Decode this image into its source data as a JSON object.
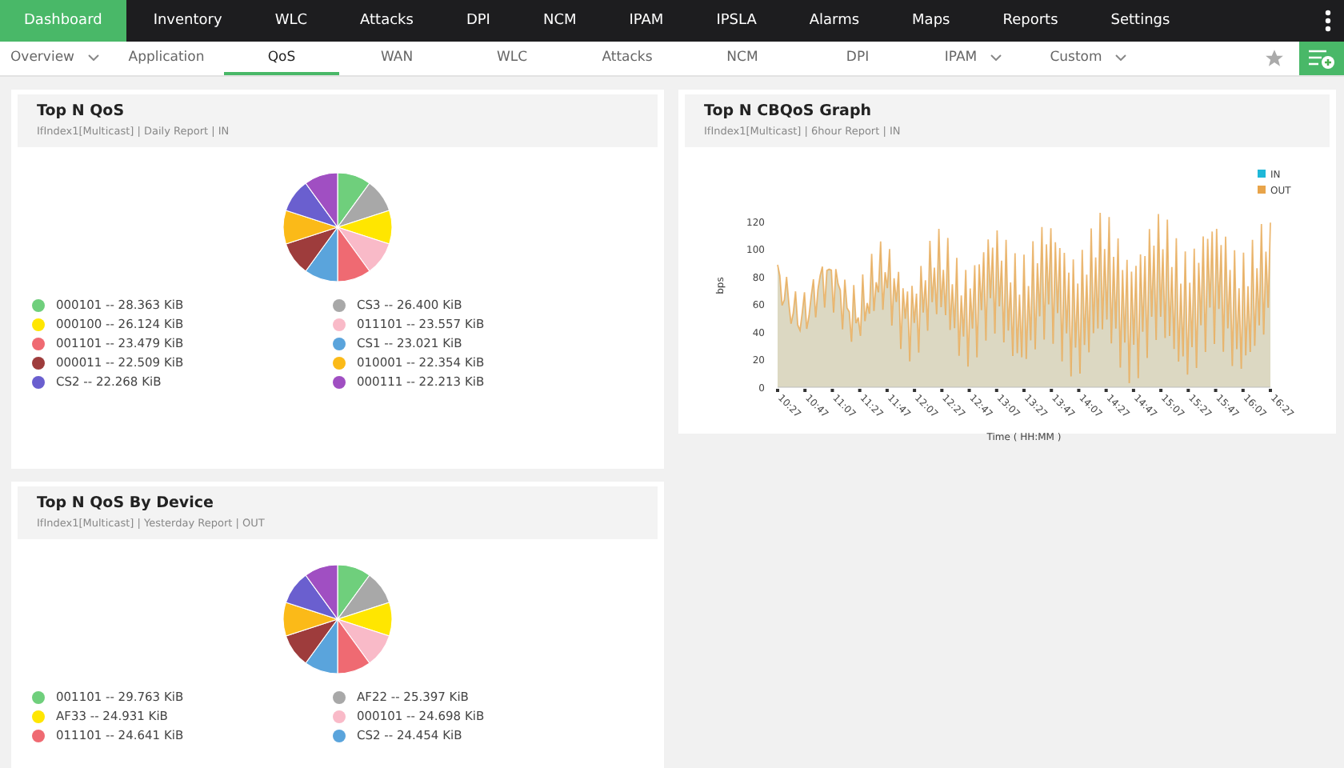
{
  "top_nav": [
    {
      "label": "Dashboard",
      "selected": true
    },
    {
      "label": "Inventory",
      "selected": false
    },
    {
      "label": "WLC",
      "selected": false
    },
    {
      "label": "Attacks",
      "selected": false
    },
    {
      "label": "DPI",
      "selected": false
    },
    {
      "label": "NCM",
      "selected": false
    },
    {
      "label": "IPAM",
      "selected": false
    },
    {
      "label": "IPSLA",
      "selected": false
    },
    {
      "label": "Alarms",
      "selected": false
    },
    {
      "label": "Maps",
      "selected": false
    },
    {
      "label": "Reports",
      "selected": false
    },
    {
      "label": "Settings",
      "selected": false
    }
  ],
  "sub_nav": [
    {
      "label": "Overview",
      "selected": false,
      "dropdown": true
    },
    {
      "label": "Application",
      "selected": false,
      "dropdown": false
    },
    {
      "label": "QoS",
      "selected": true,
      "dropdown": false
    },
    {
      "label": "WAN",
      "selected": false,
      "dropdown": false
    },
    {
      "label": "WLC",
      "selected": false,
      "dropdown": false
    },
    {
      "label": "Attacks",
      "selected": false,
      "dropdown": false
    },
    {
      "label": "NCM",
      "selected": false,
      "dropdown": false
    },
    {
      "label": "DPI",
      "selected": false,
      "dropdown": false
    },
    {
      "label": "IPAM",
      "selected": false,
      "dropdown": true
    },
    {
      "label": "Custom",
      "selected": false,
      "dropdown": true
    }
  ],
  "top_n_qos": {
    "title": "Top N QoS",
    "subtitle": "IfIndex1[Multicast] | Daily Report | IN",
    "slices": [
      {
        "color": "#6fcf7c"
      },
      {
        "color": "#a8a8a8"
      },
      {
        "color": "#ffe600"
      },
      {
        "color": "#f9bac8"
      },
      {
        "color": "#ef6a72"
      },
      {
        "color": "#5aa4dc"
      },
      {
        "color": "#9e3c3c"
      },
      {
        "color": "#fbba18"
      },
      {
        "color": "#6a5fcf"
      },
      {
        "color": "#a04fc2"
      }
    ],
    "legend": [
      {
        "label": "000101 -- 28.363 KiB",
        "color": "#6fcf7c"
      },
      {
        "label": "CS3 -- 26.400 KiB",
        "color": "#a8a8a8"
      },
      {
        "label": "000100 -- 26.124 KiB",
        "color": "#ffe600"
      },
      {
        "label": "011101 -- 23.557 KiB",
        "color": "#f9bac8"
      },
      {
        "label": "001101 -- 23.479 KiB",
        "color": "#ef6a72"
      },
      {
        "label": "CS1 -- 23.021 KiB",
        "color": "#5aa4dc"
      },
      {
        "label": "000011 -- 22.509 KiB",
        "color": "#9e3c3c"
      },
      {
        "label": "010001 -- 22.354 KiB",
        "color": "#fbba18"
      },
      {
        "label": "CS2 -- 22.268 KiB",
        "color": "#6a5fcf"
      },
      {
        "label": "000111 -- 22.213 KiB",
        "color": "#a04fc2"
      }
    ]
  },
  "cbqos_graph": {
    "title": "Top N CBQoS Graph",
    "subtitle": "IfIndex1[Multicast] | 6hour Report | IN",
    "graph": {
      "xlabel": "Time ( HH:MM )",
      "ylabel": "bps",
      "x_ticks": [
        "10:27",
        "10:47",
        "11:07",
        "11:27",
        "11:47",
        "12:07",
        "12:27",
        "12:47",
        "13:07",
        "13:27",
        "13:47",
        "14:07",
        "14:27",
        "14:47",
        "15:07",
        "15:27",
        "15:47",
        "16:07",
        "16:27"
      ],
      "y_ticks": [
        "120",
        "100",
        "80",
        "60",
        "40",
        "20",
        "0"
      ],
      "legend": [
        {
          "label": "IN",
          "color": "#1fb8d8"
        },
        {
          "label": "OUT",
          "color": "#e8a44a"
        }
      ]
    }
  },
  "top_n_qos_by_device": {
    "title": "Top N QoS By Device",
    "subtitle": "IfIndex1[Multicast] | Yesterday Report | OUT",
    "slices": [
      {
        "color": "#6fcf7c"
      },
      {
        "color": "#a8a8a8"
      },
      {
        "color": "#ffe600"
      },
      {
        "color": "#f9bac8"
      },
      {
        "color": "#ef6a72"
      },
      {
        "color": "#5aa4dc"
      },
      {
        "color": "#9e3c3c"
      },
      {
        "color": "#fbba18"
      },
      {
        "color": "#6a5fcf"
      },
      {
        "color": "#a04fc2"
      }
    ],
    "legend": [
      {
        "label": "001101 -- 29.763 KiB",
        "color": "#6fcf7c"
      },
      {
        "label": "AF22 -- 25.397 KiB",
        "color": "#a8a8a8"
      },
      {
        "label": "AF33 -- 24.931 KiB",
        "color": "#ffe600"
      },
      {
        "label": "000101 -- 24.698 KiB",
        "color": "#f9bac8"
      },
      {
        "label": "011101 -- 24.641 KiB",
        "color": "#ef6a72"
      },
      {
        "label": "CS2 -- 24.454 KiB",
        "color": "#5aa4dc"
      }
    ]
  }
}
